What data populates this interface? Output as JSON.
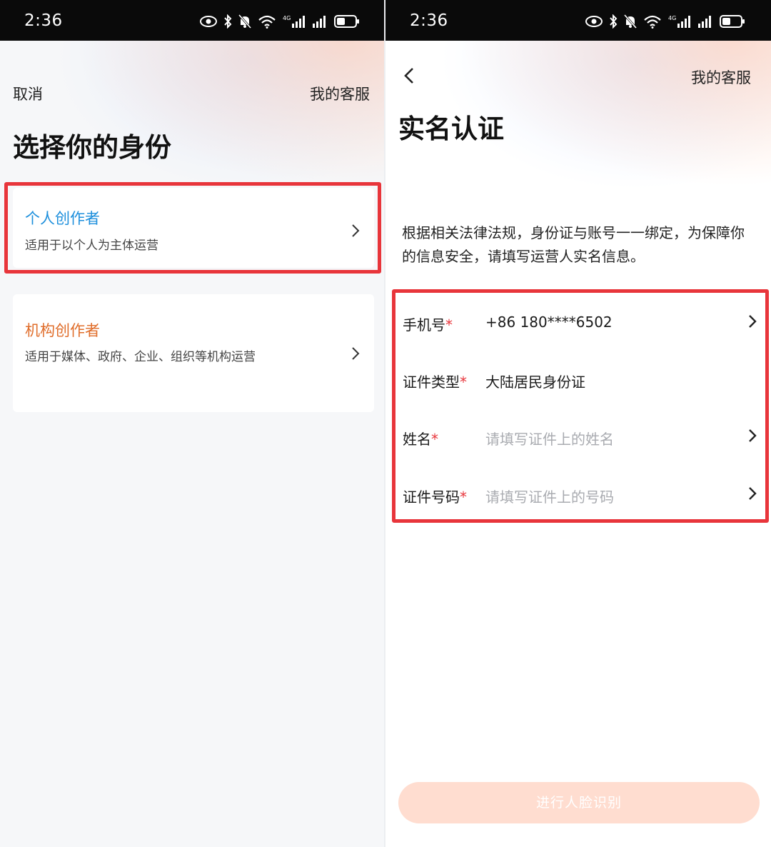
{
  "status_bar": {
    "time": "2:36"
  },
  "left_screen": {
    "cancel_label": "取消",
    "support_label": "我的客服",
    "title": "选择你的身份",
    "options": [
      {
        "title": "个人创作者",
        "desc": "适用于以个人为主体运营",
        "title_color": "#1d8fdc"
      },
      {
        "title": "机构创作者",
        "desc": "适用于媒体、政府、企业、组织等机构运营",
        "title_color": "#e06d2a"
      }
    ]
  },
  "right_screen": {
    "support_label": "我的客服",
    "title": "实名认证",
    "description": "根据相关法律法规，身份证与账号一一绑定，为保障你的信息安全，请填写运营人实名信息。",
    "fields": [
      {
        "label": "手机号",
        "required_mark": "*",
        "value": "+86 180****6502",
        "placeholder": ""
      },
      {
        "label": "证件类型",
        "required_mark": "*",
        "value": "大陆居民身份证",
        "placeholder": ""
      },
      {
        "label": "姓名",
        "required_mark": "*",
        "value": "",
        "placeholder": "请填写证件上的姓名"
      },
      {
        "label": "证件号码",
        "required_mark": "*",
        "value": "",
        "placeholder": "请填写证件上的号码"
      }
    ],
    "submit_label": "进行人脸识别"
  },
  "colors": {
    "highlight": "#e8353b",
    "button_disabled": "#ffddd0",
    "required": "#e8353b"
  },
  "icons": [
    "eye-icon",
    "bluetooth-icon",
    "bell-off-icon",
    "wifi-icon",
    "signal-icon",
    "battery-icon",
    "back-chevron-icon",
    "chevron-right-icon"
  ]
}
